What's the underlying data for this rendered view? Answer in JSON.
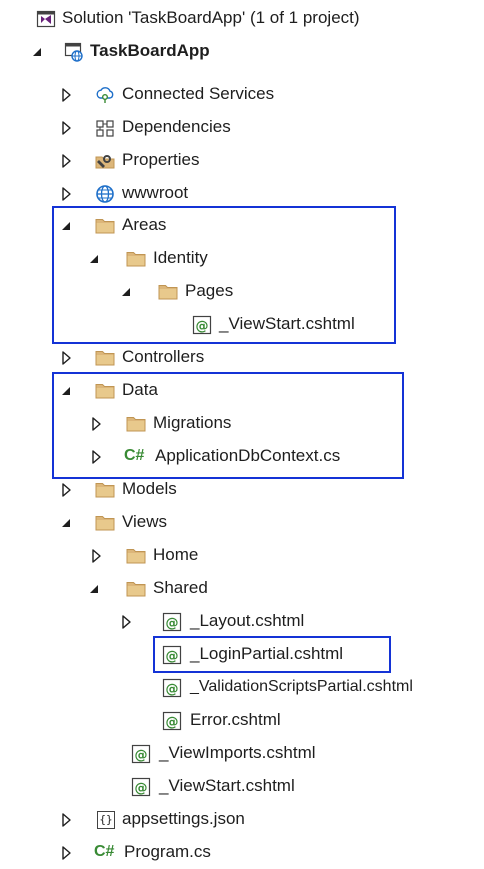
{
  "solution_explorer": {
    "solution": {
      "label": "Solution 'TaskBoardApp' (1 of 1 project)",
      "icon": "solution-icon"
    },
    "project": {
      "label": "TaskBoardApp",
      "icon": "web-project-icon",
      "expanded": true
    },
    "items": {
      "connected_services": {
        "label": "Connected Services",
        "icon": "connected-services-icon",
        "expanded": false
      },
      "dependencies": {
        "label": "Dependencies",
        "icon": "dependencies-icon",
        "expanded": false
      },
      "properties": {
        "label": "Properties",
        "icon": "properties-icon",
        "expanded": false
      },
      "wwwroot": {
        "label": "wwwroot",
        "icon": "globe-icon",
        "expanded": false
      },
      "areas": {
        "label": "Areas",
        "icon": "folder-icon",
        "expanded": true
      },
      "identity": {
        "label": "Identity",
        "icon": "folder-icon",
        "expanded": true
      },
      "pages": {
        "label": "Pages",
        "icon": "folder-icon",
        "expanded": true
      },
      "areas_viewstart": {
        "label": "_ViewStart.cshtml",
        "icon": "razor-file-icon"
      },
      "controllers": {
        "label": "Controllers",
        "icon": "folder-icon",
        "expanded": false
      },
      "data": {
        "label": "Data",
        "icon": "folder-icon",
        "expanded": true
      },
      "migrations": {
        "label": "Migrations",
        "icon": "folder-icon",
        "expanded": false
      },
      "app_db_context": {
        "label": "ApplicationDbContext.cs",
        "icon": "csharp-file-icon",
        "icon_text": "C#",
        "expanded": false
      },
      "models": {
        "label": "Models",
        "icon": "folder-icon",
        "expanded": false
      },
      "views": {
        "label": "Views",
        "icon": "folder-icon",
        "expanded": true
      },
      "home": {
        "label": "Home",
        "icon": "folder-icon",
        "expanded": false
      },
      "shared": {
        "label": "Shared",
        "icon": "folder-icon",
        "expanded": true
      },
      "layout": {
        "label": "_Layout.cshtml",
        "icon": "razor-file-icon",
        "expanded": false
      },
      "login_partial": {
        "label": "_LoginPartial.cshtml",
        "icon": "razor-file-icon"
      },
      "validation_partial": {
        "label": "_ValidationScriptsPartial.cshtml",
        "icon": "razor-file-icon"
      },
      "error": {
        "label": "Error.cshtml",
        "icon": "razor-file-icon"
      },
      "view_imports": {
        "label": "_ViewImports.cshtml",
        "icon": "razor-file-icon"
      },
      "views_viewstart": {
        "label": "_ViewStart.cshtml",
        "icon": "razor-file-icon"
      },
      "appsettings": {
        "label": "appsettings.json",
        "icon": "json-file-icon",
        "icon_text": "{}",
        "expanded": false
      },
      "program": {
        "label": "Program.cs",
        "icon": "csharp-file-icon",
        "icon_text": "C#",
        "expanded": false
      }
    }
  },
  "colors": {
    "highlight_border": "#1433d6",
    "folder": "#dcb67a",
    "folder_dark": "#c09553",
    "razor_green": "#388a34",
    "csharp_green": "#388a34",
    "globe_blue": "#1e6fc9",
    "solution_purple": "#68217a",
    "text": "#1e1e1e"
  }
}
